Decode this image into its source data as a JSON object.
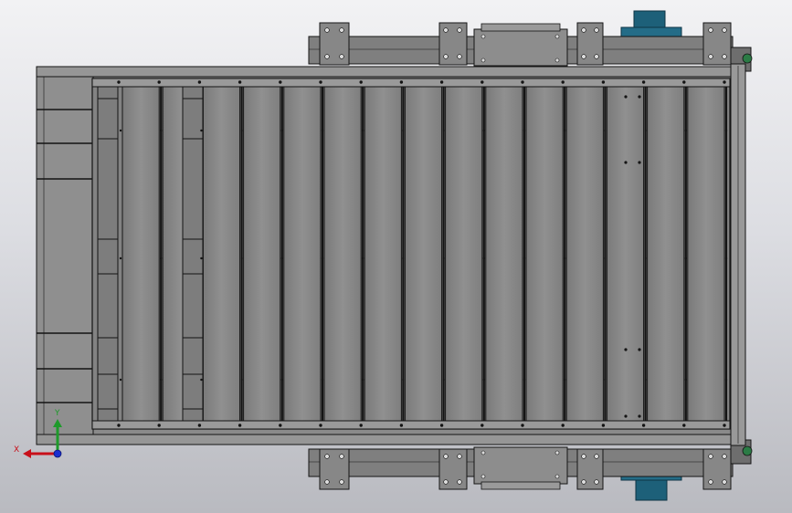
{
  "viewport": {
    "background_top": "#f2f2f4",
    "background_bottom": "#b9bac0"
  },
  "model": {
    "part_color": "#8b8b8b",
    "edge_color": "#141414",
    "motor_color": "#1d6079",
    "slat_count": 15
  },
  "triad": {
    "x_label": "X",
    "y_label": "Y",
    "x_color": "#c8101a",
    "y_color": "#1e9a2a",
    "z_color": "#1b2fd0"
  }
}
